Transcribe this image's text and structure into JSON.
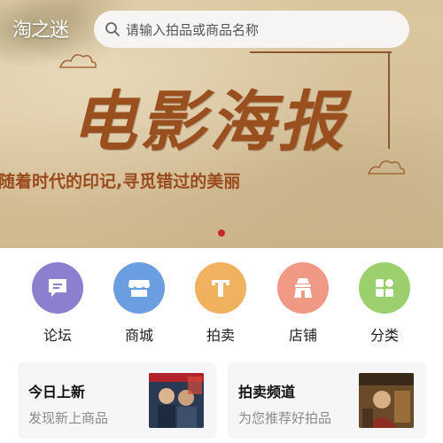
{
  "header": {
    "logo_text": "淘之迷",
    "search": {
      "placeholder": "请输入拍品或商品名称",
      "icon": "search-icon"
    }
  },
  "banner": {
    "title": "电影海报",
    "slogan": "随着时代的印记,寻觅错过的美丽",
    "active_slide": 1,
    "accent_color": "#9a4f1f"
  },
  "categories": [
    {
      "label": "论坛",
      "icon": "forum-icon",
      "color": "#8b7fd0"
    },
    {
      "label": "商城",
      "icon": "store-icon",
      "color": "#6a9ee0"
    },
    {
      "label": "拍卖",
      "icon": "auction-icon",
      "color": "#f0b25e"
    },
    {
      "label": "店铺",
      "icon": "shop-icon",
      "color": "#f09a86"
    },
    {
      "label": "分类",
      "icon": "grid-icon",
      "color": "#9ccf6e"
    }
  ],
  "cards": [
    {
      "title": "今日上新",
      "subtitle": "发现新上商品",
      "thumb": "poster-thumbnail"
    },
    {
      "title": "拍卖频道",
      "subtitle": "为您推荐好拍品",
      "thumb": "poster-thumbnail"
    }
  ]
}
